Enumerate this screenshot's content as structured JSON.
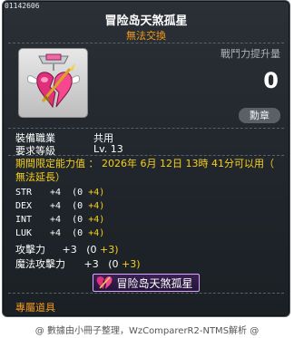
{
  "item": {
    "id": "01142606",
    "name": "冒险岛天煞孤星",
    "trade": "無法交換",
    "icon": "broken-heart-medal-icon"
  },
  "combat_power": {
    "label": "戰鬥力提升量",
    "value": "0"
  },
  "badge": "勳章",
  "requirements": [
    {
      "label": "裝備職業",
      "value": "共用"
    },
    {
      "label": "要求等級",
      "value": "Lv. 13"
    }
  ],
  "period": {
    "line1": "期間限定能力值 ： 2026年 6月 12日 13時 41分可以用（",
    "line2": "無法延長）"
  },
  "stats": [
    {
      "name": "STR",
      "total": "+4",
      "base": "(0",
      "bonus": "+4)"
    },
    {
      "name": "DEX",
      "total": "+4",
      "base": "(0",
      "bonus": "+4)"
    },
    {
      "name": "INT",
      "total": "+4",
      "base": "(0",
      "bonus": "+4)"
    },
    {
      "name": "LUK",
      "total": "+4",
      "base": "(0",
      "bonus": "+4)"
    }
  ],
  "stats_cjk": [
    {
      "name": "攻擊力",
      "total": "+3",
      "base": "(0",
      "bonus": "+3)"
    },
    {
      "name": "魔法攻擊力",
      "total": "+3",
      "base": "(0",
      "bonus": "+3)"
    }
  ],
  "set_label": "冒险岛天煞孤星",
  "exclusive": "專屬道具",
  "footer": "@ 數據由小冊子整理，WzComparerR2-NTMS解析 @",
  "colors": {
    "orange": "#f79b1c",
    "yellow": "#f7d01c",
    "panel": "#21272c"
  }
}
